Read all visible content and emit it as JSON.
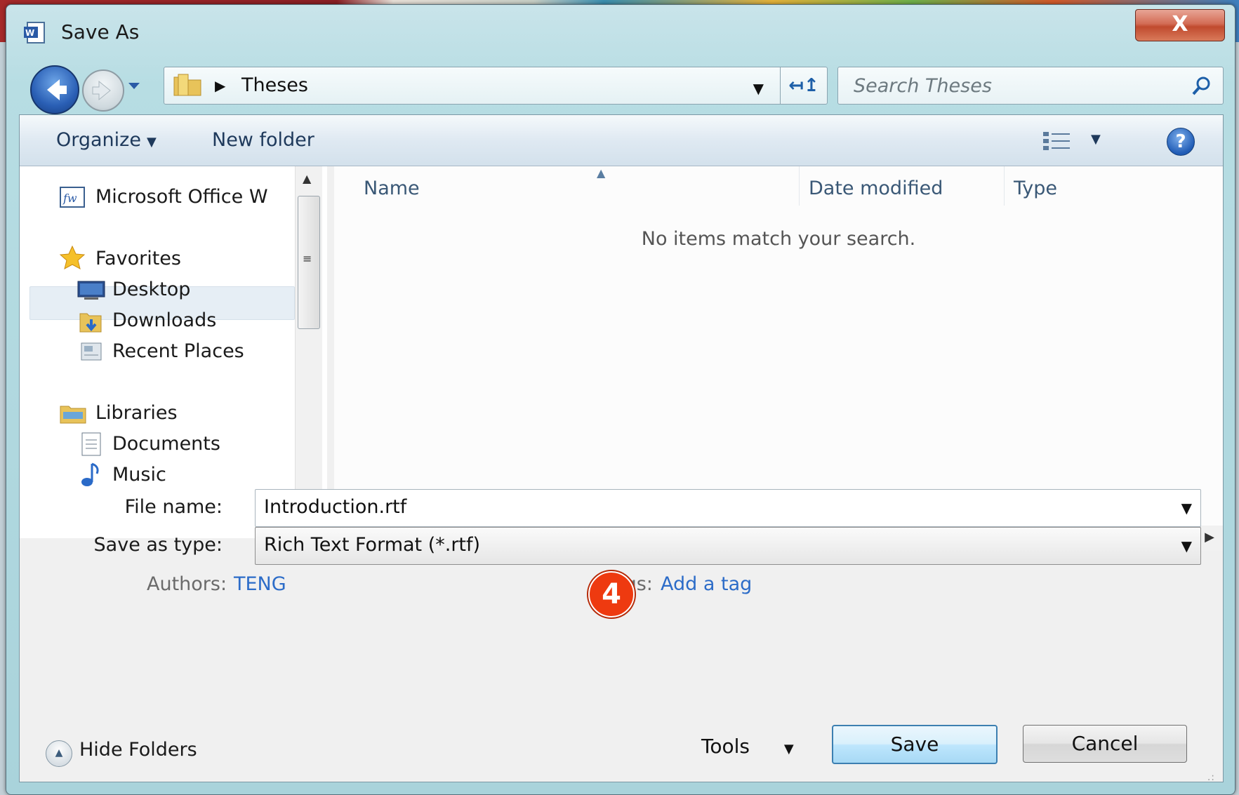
{
  "window": {
    "title": "Save As",
    "close_label": "X"
  },
  "address": {
    "path": "Theses",
    "search_placeholder": "Search Theses"
  },
  "toolbar": {
    "organize": "Organize",
    "new_folder": "New folder"
  },
  "nav": {
    "top_item": "Microsoft Office W",
    "favorites": "Favorites",
    "favorite_items": [
      "Desktop",
      "Downloads",
      "Recent Places"
    ],
    "selected": "Desktop",
    "libraries": "Libraries",
    "library_items": [
      "Documents",
      "Music"
    ]
  },
  "filelist": {
    "columns": [
      "Name",
      "Date modified",
      "Type"
    ],
    "empty_message": "No items match your search."
  },
  "form": {
    "file_name_label": "File name:",
    "file_name_value": "Introduction.rtf",
    "save_type_label": "Save as type:",
    "save_type_value": "Rich Text Format (*.rtf)",
    "authors_label": "Authors:",
    "authors_value": "TENG",
    "tags_label": "Tags:",
    "tags_value": "Add a tag"
  },
  "annotation": {
    "step_number": "4",
    "color": "#ee3a10"
  },
  "footer": {
    "hide_folders": "Hide Folders",
    "tools": "Tools",
    "save": "Save",
    "cancel": "Cancel"
  },
  "icons": [
    "word-doc-icon",
    "back-arrow-icon",
    "forward-arrow-icon",
    "folder-icon",
    "refresh-icon",
    "search-icon",
    "views-icon",
    "help-icon",
    "star-icon",
    "desktop-icon",
    "downloads-icon",
    "recent-places-icon",
    "libraries-icon",
    "documents-icon",
    "music-icon"
  ]
}
